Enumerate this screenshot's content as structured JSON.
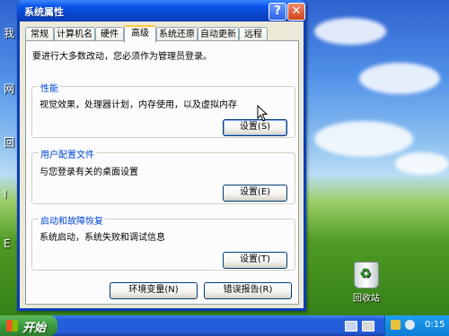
{
  "window": {
    "title": "系统属性",
    "help_label": "?",
    "close_label": "✕"
  },
  "tabs": [
    {
      "label": "常规"
    },
    {
      "label": "计算机名"
    },
    {
      "label": "硬件"
    },
    {
      "label": "高级",
      "active": true
    },
    {
      "label": "系统还原"
    },
    {
      "label": "自动更新"
    },
    {
      "label": "远程"
    }
  ],
  "page": {
    "intro": "要进行大多数改动，您必须作为管理员登录。",
    "performance": {
      "title": "性能",
      "desc": "视觉效果，处理器计划，内存使用，以及虚拟内存",
      "button": "设置(S)"
    },
    "profiles": {
      "title": "用户配置文件",
      "desc": "与您登录有关的桌面设置",
      "button": "设置(E)"
    },
    "startup": {
      "title": "启动和故障恢复",
      "desc": "系统启动，系统失败和调试信息",
      "button": "设置(T)"
    },
    "env_button": "环境变量(N)",
    "error_button": "错误报告(R)"
  },
  "desktop": {
    "recycle_bin": "回收站",
    "left_labels": [
      "我",
      "网",
      "回",
      "I",
      "E"
    ]
  },
  "taskbar": {
    "start_label": "开始",
    "clock": "0:15"
  },
  "colors": {
    "title_bar": "#0a54e8",
    "dialog_bg": "#ece9d8",
    "group_title": "#0046d5",
    "taskbar": "#245edb",
    "start_button": "#3c9a3c",
    "close_button": "#d1431b"
  }
}
